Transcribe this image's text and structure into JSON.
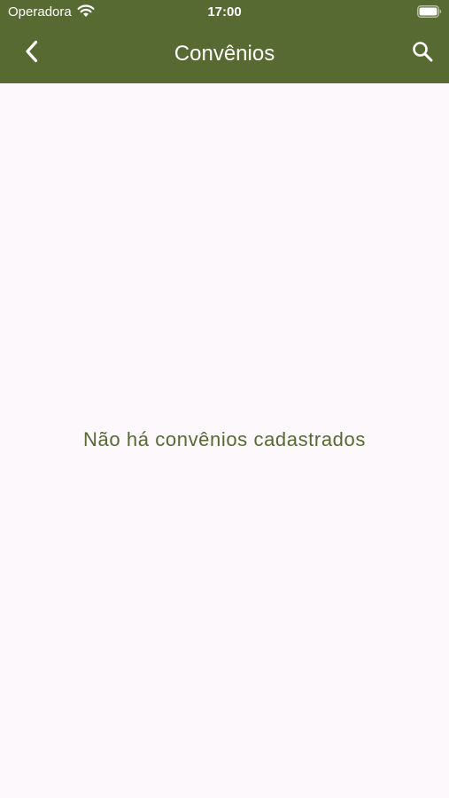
{
  "status_bar": {
    "carrier": "Operadora",
    "time": "17:00",
    "wifi_icon": "wifi-icon",
    "battery_icon": "battery-full-icon"
  },
  "navbar": {
    "title": "Convênios",
    "back_icon": "chevron-left-icon",
    "search_icon": "search-icon"
  },
  "content": {
    "empty_message": "Não há convênios cadastrados"
  },
  "colors": {
    "primary": "#566a32",
    "background": "#fcf8fc",
    "on_primary": "#ffffff"
  }
}
